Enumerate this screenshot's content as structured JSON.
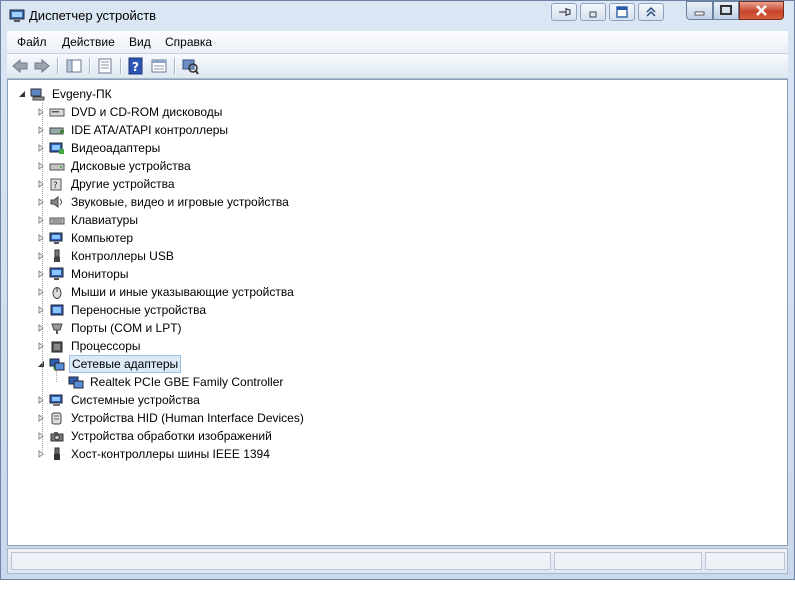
{
  "window": {
    "title": "Диспетчер устройств"
  },
  "menu": {
    "items": [
      "Файл",
      "Действие",
      "Вид",
      "Справка"
    ]
  },
  "toolbar": {
    "buttons": [
      "back-icon",
      "forward-icon",
      "show-hide-tree-icon",
      "properties-icon",
      "help-icon",
      "view-icon",
      "scan-hardware-icon"
    ]
  },
  "tree": {
    "root": "Evgeny-ПК",
    "categories": [
      {
        "label": "DVD и CD-ROM дисководы",
        "icon": "dvd-drive-icon"
      },
      {
        "label": "IDE ATA/ATAPI контроллеры",
        "icon": "ide-controller-icon"
      },
      {
        "label": "Видеоадаптеры",
        "icon": "display-adapter-icon"
      },
      {
        "label": "Дисковые устройства",
        "icon": "disk-drive-icon"
      },
      {
        "label": "Другие устройства",
        "icon": "unknown-device-icon"
      },
      {
        "label": "Звуковые, видео и игровые устройства",
        "icon": "speaker-icon"
      },
      {
        "label": "Клавиатуры",
        "icon": "keyboard-icon"
      },
      {
        "label": "Компьютер",
        "icon": "computer-icon"
      },
      {
        "label": "Контроллеры USB",
        "icon": "usb-icon"
      },
      {
        "label": "Мониторы",
        "icon": "monitor-icon"
      },
      {
        "label": "Мыши и иные указывающие устройства",
        "icon": "mouse-icon"
      },
      {
        "label": "Переносные устройства",
        "icon": "portable-device-icon"
      },
      {
        "label": "Порты (COM и LPT)",
        "icon": "port-icon"
      },
      {
        "label": "Процессоры",
        "icon": "processor-icon"
      },
      {
        "label": "Сетевые адаптеры",
        "icon": "network-adapter-icon",
        "expanded": true,
        "selected": true
      },
      {
        "label": "Системные устройства",
        "icon": "system-device-icon"
      },
      {
        "label": "Устройства HID (Human Interface Devices)",
        "icon": "hid-icon"
      },
      {
        "label": "Устройства обработки изображений",
        "icon": "camera-icon"
      },
      {
        "label": "Хост-контроллеры шины IEEE 1394",
        "icon": "ieee1394-icon"
      }
    ],
    "network_child": "Realtek PCIe GBE Family Controller"
  },
  "colors": {
    "selection": "#dceaf8",
    "titlebar": "#c9d8ec",
    "close_button": "#c7452b"
  }
}
